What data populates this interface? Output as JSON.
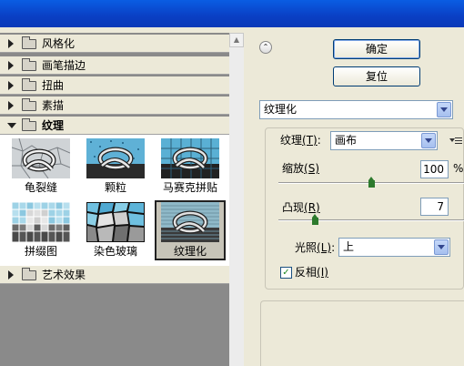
{
  "categories": [
    {
      "label": "风格化",
      "expanded": false
    },
    {
      "label": "画笔描边",
      "expanded": false
    },
    {
      "label": "扭曲",
      "expanded": false
    },
    {
      "label": "素描",
      "expanded": false
    },
    {
      "label": "纹理",
      "expanded": true
    },
    {
      "label": "艺术效果",
      "expanded": false
    }
  ],
  "textures": [
    {
      "label": "龟裂缝",
      "icon": "craquelure-thumbnail"
    },
    {
      "label": "颗粒",
      "icon": "grain-thumbnail"
    },
    {
      "label": "马赛克拼贴",
      "icon": "mosaic-tiles-thumbnail"
    },
    {
      "label": "拼缀图",
      "icon": "patchwork-thumbnail"
    },
    {
      "label": "染色玻璃",
      "icon": "stained-glass-thumbnail"
    },
    {
      "label": "纹理化",
      "icon": "texturizer-thumbnail",
      "selected": true
    }
  ],
  "buttons": {
    "ok": "确定",
    "reset": "复位"
  },
  "filter_select": {
    "value": "纹理化"
  },
  "settings": {
    "texture_label": "纹理",
    "texture_key": "(T)",
    "texture_value": "画布",
    "scaling_label": "缩放",
    "scaling_key": "(S)",
    "scaling_value": "100",
    "scaling_unit": "%",
    "relief_label": "凸现",
    "relief_key": "(R)",
    "relief_value": "7",
    "light_label": "光照",
    "light_key": "(L)",
    "light_suffix": ":",
    "light_value": "上",
    "invert_label": "反相",
    "invert_key": "(I)",
    "invert_checked": true,
    "scaling_level": 0.5,
    "relief_level": 0.2
  },
  "colors": {
    "titlebar": "#0a4fd4",
    "left_bg": "#8a8a8a",
    "dialog_bg": "#ece9d8",
    "knob": "#2d7a2d"
  }
}
